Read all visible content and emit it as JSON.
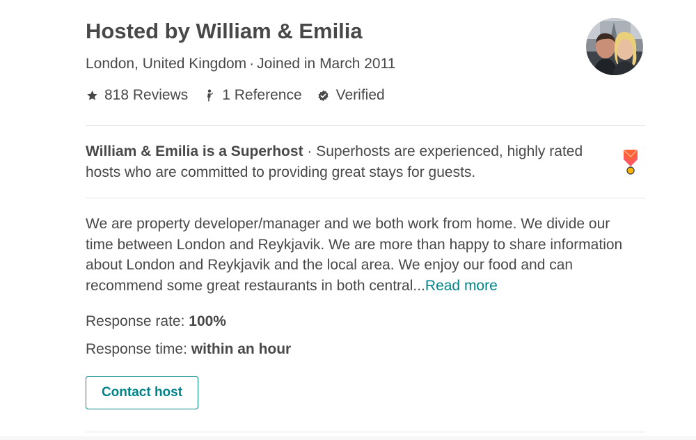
{
  "host": {
    "title": "Hosted by William & Emilia",
    "location": "London, United Kingdom",
    "separator": "·",
    "joined": "Joined in March 2011",
    "avatar_alt": "William & Emilia"
  },
  "stats": [
    {
      "icon": "star-icon",
      "label": "818 Reviews"
    },
    {
      "icon": "reference-icon",
      "label": "1 Reference"
    },
    {
      "icon": "verified-shield-icon",
      "label": "Verified"
    }
  ],
  "superhost": {
    "title": "William & Emilia is a Superhost",
    "separator": " · ",
    "description": "Superhosts are experienced, highly rated hosts who are committed to providing great stays for guests.",
    "badge_icon": "superhost-badge-icon"
  },
  "about": {
    "text": "We are property developer/manager and we both work from home. We divide our time between London and Reykjavik. We are more than happy to share information about London and Reykjavik and the local area. We enjoy our food and can recommend some great restaurants in both central...",
    "read_more": "Read more"
  },
  "response": {
    "rate_label": "Response rate: ",
    "rate_value": "100%",
    "time_label": "Response time: ",
    "time_value": "within an hour"
  },
  "contact": {
    "button_label": "Contact host"
  },
  "colors": {
    "text": "#484848",
    "accent": "#008489",
    "divider": "#e4e4e4",
    "badge": "#ff5a5f"
  }
}
